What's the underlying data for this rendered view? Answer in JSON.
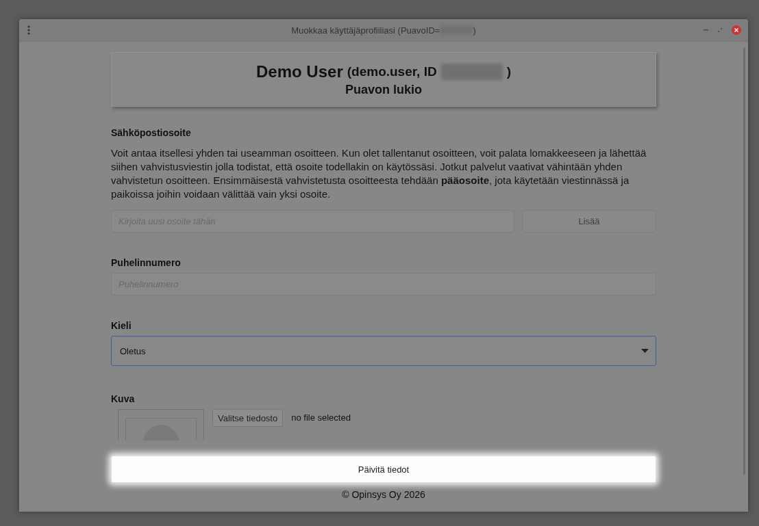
{
  "window": {
    "title_before": "Muokkaa käyttäjäprofiiliasi (PuavoID=",
    "title_after": ")"
  },
  "header": {
    "name": "Demo User",
    "login": "(demo.user, ID",
    "login_after": ")",
    "school": "Puavon lukio"
  },
  "email": {
    "label": "Sähköpostiosoite",
    "description": "Voit antaa itsellesi yhden tai useamman osoitteen. Kun olet tallentanut osoitteen, voit palata lomakkeeseen ja lähettää siihen vahvistusviestin jolla todistat, että osoite todellakin on käytössäsi. Jotkut palvelut vaativat vähintään yhden vahvistetun osoitteen. Ensimmäisestä vahvistetusta osoitteesta tehdään **pääosoite**, jota käytetään viestinnässä ja paikoissa joihin voidaan välittää vain yksi osoite.",
    "placeholder": "Kirjoita uusi osoite tähän",
    "add_button": {
      "label": "Lisää",
      "disabled": true
    }
  },
  "phone": {
    "label": "Puhelinnumero",
    "placeholder": "Puhelinnumero"
  },
  "language": {
    "label": "Kieli",
    "value": "Oletus",
    "focused": true
  },
  "photo": {
    "label": "Kuva",
    "choose_button": "Valitse tiedosto",
    "file_status": "no file selected"
  },
  "submit_button": "Päivitä tiedot",
  "footer": "© Opinsys Oy 2026"
}
